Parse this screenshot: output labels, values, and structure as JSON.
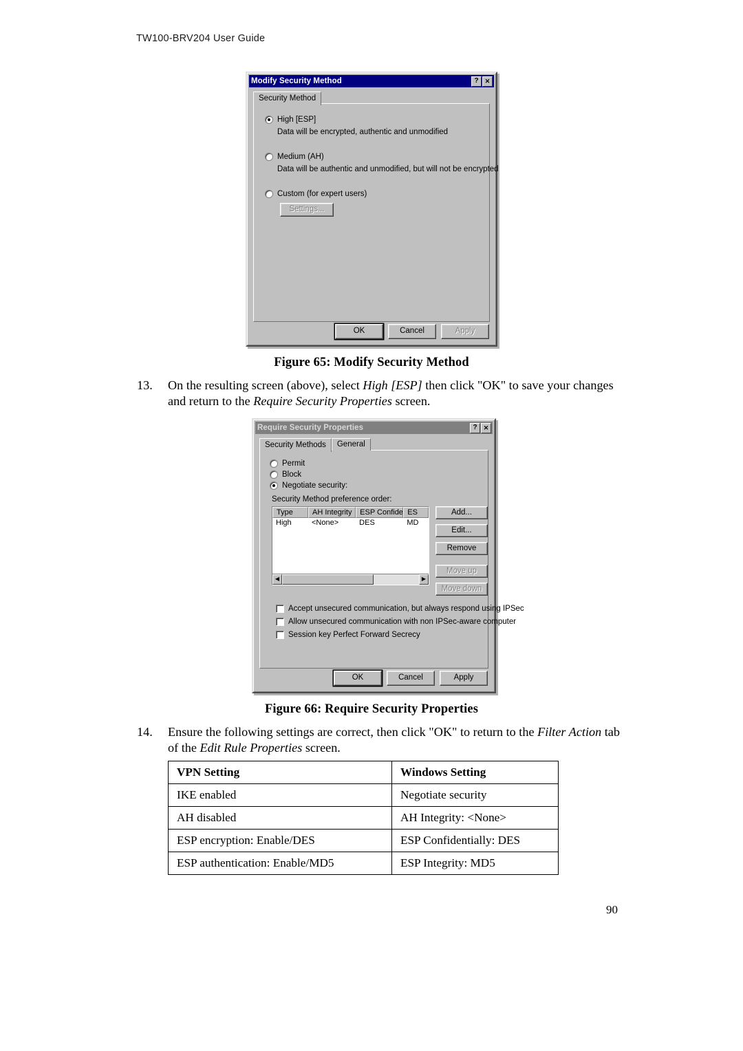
{
  "page": {
    "header": "TW100-BRV204  User Guide",
    "number": "90"
  },
  "figure65": {
    "caption": "Figure 65: Modify Security Method",
    "dialog": {
      "title": "Modify Security Method",
      "help_button": "?",
      "close_button": "✕",
      "tabs": [
        {
          "label": "Security Method",
          "selected": true
        }
      ],
      "options": [
        {
          "label": "High [ESP]",
          "selected": true,
          "description": "Data will be encrypted, authentic and unmodified"
        },
        {
          "label": "Medium (AH)",
          "selected": false,
          "description": "Data will be authentic and unmodified, but will not be encrypted"
        },
        {
          "label": "Custom (for expert users)",
          "selected": false,
          "description": ""
        }
      ],
      "settings_button": {
        "label": "Settings...",
        "enabled": false
      },
      "buttons": [
        {
          "label": "OK",
          "enabled": true,
          "default": true
        },
        {
          "label": "Cancel",
          "enabled": true,
          "default": false
        },
        {
          "label": "Apply",
          "enabled": false,
          "default": false
        }
      ]
    }
  },
  "step13": {
    "number": "13.",
    "part1": "On the resulting screen (above), select ",
    "em1": "High [ESP]",
    "part2": " then click \"OK\" to save your changes and return to the ",
    "em2": "Require Security Properties",
    "part3": " screen."
  },
  "figure66": {
    "caption": "Figure 66: Require Security Properties",
    "dialog": {
      "title": "Require Security Properties",
      "help_button": "?",
      "close_button": "✕",
      "tabs": [
        {
          "label": "Security Methods",
          "selected": true
        },
        {
          "label": "General",
          "selected": false
        }
      ],
      "options": [
        {
          "label": "Permit",
          "selected": false
        },
        {
          "label": "Block",
          "selected": false
        },
        {
          "label": "Negotiate security:",
          "selected": true
        }
      ],
      "list_label": "Security Method preference order:",
      "list_columns": [
        "Type",
        "AH Integrity",
        "ESP Confidential..",
        "ES"
      ],
      "list_rows": [
        [
          "High",
          "<None>",
          "DES",
          "MD"
        ]
      ],
      "side_buttons": [
        {
          "label": "Add...",
          "enabled": true
        },
        {
          "label": "Edit...",
          "enabled": true
        },
        {
          "label": "Remove",
          "enabled": true
        },
        {
          "label": "Move up",
          "enabled": false
        },
        {
          "label": "Move down",
          "enabled": false
        }
      ],
      "checkboxes": [
        {
          "label": "Accept unsecured communication, but always respond using IPSec",
          "checked": false
        },
        {
          "label": "Allow unsecured communication with non IPSec-aware computer",
          "checked": false
        },
        {
          "label": "Session key Perfect Forward Secrecy",
          "checked": false
        }
      ],
      "buttons": [
        {
          "label": "OK",
          "enabled": true,
          "default": true
        },
        {
          "label": "Cancel",
          "enabled": true,
          "default": false
        },
        {
          "label": "Apply",
          "enabled": true,
          "default": false
        }
      ]
    }
  },
  "step14": {
    "number": "14.",
    "part1": "Ensure the following settings are correct, then click \"OK\" to return to the ",
    "em1": "Filter Action",
    "part2": " tab of the ",
    "em2": "Edit Rule Properties",
    "part3": " screen."
  },
  "vpn_table": {
    "headers": [
      "VPN Setting",
      "Windows Setting"
    ],
    "rows": [
      [
        "IKE enabled",
        "Negotiate security"
      ],
      [
        "AH disabled",
        "AH Integrity: <None>"
      ],
      [
        "ESP encryption: Enable/DES",
        "ESP Confidentially: DES"
      ],
      [
        "ESP authentication: Enable/MD5",
        "ESP Integrity: MD5"
      ]
    ]
  },
  "colors": {
    "titlebar_active": "#000080",
    "titlebar_inactive": "#808080",
    "dialog_face": "#c0c0c0"
  }
}
